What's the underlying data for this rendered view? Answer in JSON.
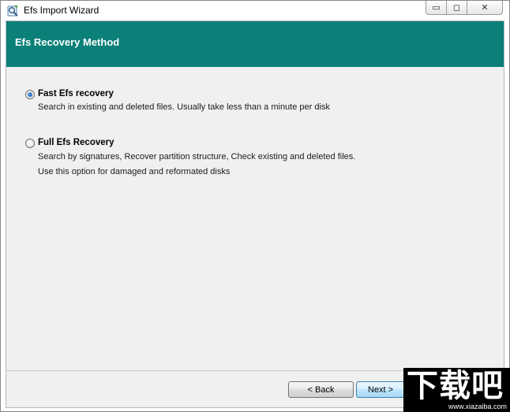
{
  "window": {
    "title": "Efs Import Wizard",
    "controls": {
      "minimize": "▭",
      "maximize": "◻",
      "close": "✕"
    }
  },
  "header": {
    "title": "Efs Recovery Method",
    "band_color": "#0a8078"
  },
  "options": [
    {
      "label": "Fast Efs recovery",
      "checked": true,
      "description": [
        "Search in existing and deleted files. Usually take less than a minute per disk"
      ]
    },
    {
      "label": "Full Efs Recovery",
      "checked": false,
      "description": [
        "Search by signatures, Recover partition structure, Check existing and deleted files.",
        "Use this option for damaged and reformated disks"
      ]
    }
  ],
  "footer": {
    "back_label": "< Back",
    "next_label": "Next >"
  },
  "watermark": {
    "logo": "下载吧",
    "url": "www.xiazaiba.com"
  }
}
